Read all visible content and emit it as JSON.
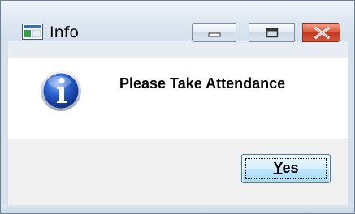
{
  "window": {
    "title": "Info",
    "controls": {
      "minimize_icon": "minimize-icon",
      "maximize_icon": "maximize-icon",
      "close_icon": "close-icon"
    },
    "app_icon": "window-app-icon"
  },
  "dialog": {
    "icon": "information-icon",
    "message": "Please Take Attendance",
    "buttons": [
      {
        "label": "Yes",
        "mnemonic": "Y",
        "rest": "es"
      }
    ]
  },
  "colors": {
    "close_button": "#c3361f",
    "info_icon_blue": "#1f4fb5",
    "button_blue": "#bee6fd"
  }
}
